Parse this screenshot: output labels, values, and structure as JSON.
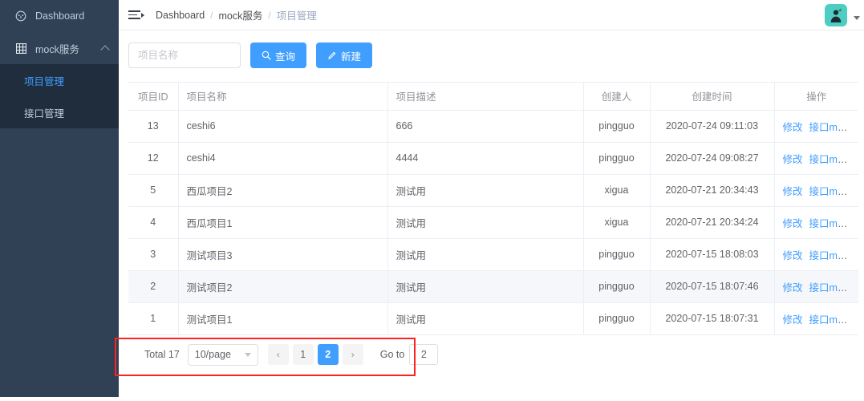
{
  "sidebar": {
    "items": [
      {
        "label": "Dashboard",
        "icon": "dashboard-icon"
      },
      {
        "label": "mock服务",
        "icon": "grid-icon",
        "expanded": true,
        "children": [
          {
            "label": "项目管理",
            "active": true
          },
          {
            "label": "接口管理",
            "active": false
          }
        ]
      }
    ]
  },
  "header": {
    "menu_toggle_icon": "hamburger-collapse-icon",
    "breadcrumb": [
      "Dashboard",
      "mock服务",
      "项目管理"
    ],
    "breadcrumb_separator": "/",
    "avatar_icon": "user-avatar",
    "avatar_color": "#4ecdc4",
    "dropdown_icon": "caret-down-icon"
  },
  "filter": {
    "search_placeholder": "项目名称",
    "search_value": "",
    "query_button": "查询",
    "query_icon": "search-icon",
    "create_button": "新建",
    "create_icon": "edit-pen-icon"
  },
  "table": {
    "columns": [
      "项目ID",
      "项目名称",
      "项目描述",
      "创建人",
      "创建时间",
      "操作"
    ],
    "action_labels": [
      "修改",
      "接口mock"
    ],
    "rows": [
      {
        "id": "13",
        "name": "ceshi6",
        "desc": "666",
        "creator": "pingguo",
        "time": "2020-07-24 09:11:03",
        "hovered": false
      },
      {
        "id": "12",
        "name": "ceshi4",
        "desc": "4444",
        "creator": "pingguo",
        "time": "2020-07-24 09:08:27",
        "hovered": false
      },
      {
        "id": "5",
        "name": "西瓜项目2",
        "desc": "测试用",
        "creator": "xigua",
        "time": "2020-07-21 20:34:43",
        "hovered": false
      },
      {
        "id": "4",
        "name": "西瓜项目1",
        "desc": "测试用",
        "creator": "xigua",
        "time": "2020-07-21 20:34:24",
        "hovered": false
      },
      {
        "id": "3",
        "name": "测试项目3",
        "desc": "测试用",
        "creator": "pingguo",
        "time": "2020-07-15 18:08:03",
        "hovered": false
      },
      {
        "id": "2",
        "name": "测试项目2",
        "desc": "测试用",
        "creator": "pingguo",
        "time": "2020-07-15 18:07:46",
        "hovered": true
      },
      {
        "id": "1",
        "name": "测试项目1",
        "desc": "测试用",
        "creator": "pingguo",
        "time": "2020-07-15 18:07:31",
        "hovered": false
      }
    ]
  },
  "pagination": {
    "total_label": "Total 17",
    "page_size_label": "10/page",
    "prev_icon": "chevron-left-icon",
    "next_icon": "chevron-right-icon",
    "pages": [
      "1",
      "2"
    ],
    "current_page": "2",
    "next_disabled": true,
    "goto_label": "Go to",
    "goto_value": "2"
  },
  "annotation": {
    "color": "#fd2222"
  }
}
